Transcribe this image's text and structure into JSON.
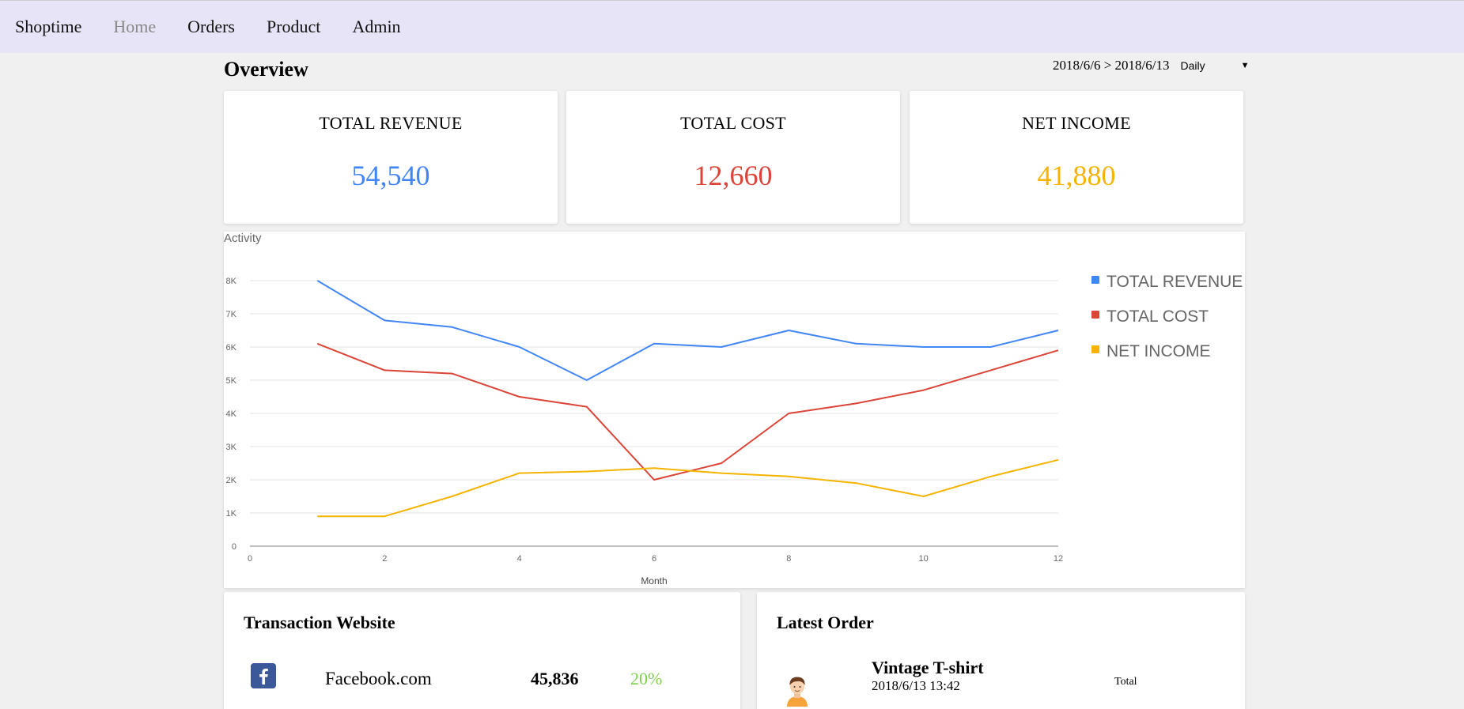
{
  "nav": {
    "brand": "Shoptime",
    "items": [
      {
        "label": "Home",
        "active": true
      },
      {
        "label": "Orders",
        "active": false
      },
      {
        "label": "Product",
        "active": false
      },
      {
        "label": "Admin",
        "active": false
      }
    ]
  },
  "overview": {
    "title": "Overview",
    "date_range": "2018/6/6 > 2018/6/13",
    "period": "Daily"
  },
  "cards": [
    {
      "label": "TOTAL REVENUE",
      "value": "54,540",
      "color": "#4285f4"
    },
    {
      "label": "TOTAL COST",
      "value": "12,660",
      "color": "#db4437"
    },
    {
      "label": "NET INCOME",
      "value": "41,880",
      "color": "#f4b400"
    }
  ],
  "chart_data": {
    "type": "line",
    "title": "Activity",
    "xlabel": "Month",
    "ylabel": "",
    "xlim": [
      0,
      12
    ],
    "ylim": [
      0,
      8000
    ],
    "xticks": [
      0,
      2,
      4,
      6,
      8,
      10,
      12
    ],
    "yticks": [
      0,
      1000,
      2000,
      3000,
      4000,
      5000,
      6000,
      7000,
      8000
    ],
    "ytick_labels": [
      "0",
      "1K",
      "2K",
      "3K",
      "4K",
      "5K",
      "6K",
      "7K",
      "8K"
    ],
    "grid": true,
    "legend": "right",
    "x": [
      1,
      2,
      3,
      4,
      5,
      6,
      7,
      8,
      9,
      10,
      11,
      12
    ],
    "series": [
      {
        "name": "TOTAL REVENUE",
        "color": "#4285f4",
        "values": [
          8000,
          6800,
          6600,
          6000,
          5000,
          6100,
          6000,
          6500,
          6100,
          6000,
          6000,
          6500
        ]
      },
      {
        "name": "TOTAL COST",
        "color": "#db4437",
        "values": [
          6100,
          5300,
          5200,
          4500,
          4200,
          2000,
          2500,
          4000,
          4300,
          4700,
          5300,
          5900
        ]
      },
      {
        "name": "NET INCOME",
        "color": "#f4b400",
        "values": [
          900,
          900,
          1500,
          2200,
          2250,
          2350,
          2200,
          2100,
          1900,
          1500,
          2100,
          2600
        ]
      }
    ]
  },
  "transactions": {
    "title": "Transaction Website",
    "rows": [
      {
        "icon": "facebook-icon",
        "site": "Facebook.com",
        "amount": "45,836",
        "percent": "20%"
      }
    ]
  },
  "latest_order": {
    "title": "Latest Order",
    "items": [
      {
        "icon": "person-avatar-icon",
        "name": "Vintage T-shirt",
        "time": "2018/6/13 13:42",
        "total_label": "Total"
      }
    ]
  }
}
